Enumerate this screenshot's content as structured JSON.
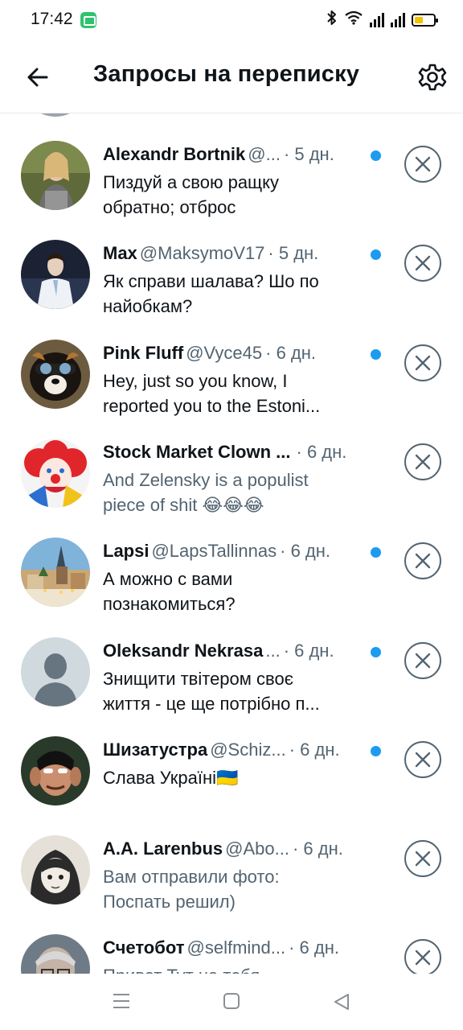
{
  "status_bar": {
    "time": "17:42",
    "icons": [
      "message-app-icon",
      "bluetooth-icon",
      "wifi-icon",
      "signal-icon",
      "signal-r-icon",
      "battery-icon"
    ],
    "battery_color": "#f2c200"
  },
  "header": {
    "title": "Запросы на переписку",
    "back_icon": "arrow-left-icon",
    "settings_icon": "gear-icon"
  },
  "colors": {
    "primary_text": "#0f1419",
    "secondary_text": "#536471",
    "unread_dot": "#1d9bf0",
    "divider": "#e7e9ea"
  },
  "requests": [
    {
      "name": "Alexandr Bortnik",
      "handle": "@...",
      "time": "· 5 дн.",
      "unread": true,
      "muted": false,
      "lines": [
        "Пиздуй а свою ращку",
        "обратно; отброс"
      ]
    },
    {
      "name": "Max",
      "handle": "@MaksymoV17",
      "time": "· 5 дн.",
      "unread": true,
      "muted": false,
      "lines": [
        "Як справи шалава? Шо по",
        "найобкам?"
      ]
    },
    {
      "name": "Pink Fluff",
      "handle": "@Vyce45",
      "time": "· 6 дн.",
      "unread": true,
      "muted": false,
      "lines": [
        "Hey, just so you know, I",
        "reported you to the Estoni..."
      ]
    },
    {
      "name": "Stock Market Clown ...",
      "handle": "",
      "time": "· 6 дн.",
      "unread": false,
      "muted": true,
      "lines": [
        "And Zelensky is a populist",
        "piece of shit 😂😂😂"
      ]
    },
    {
      "name": "Lapsi",
      "handle": "@LapsTallinnas",
      "time": "· 6 дн.",
      "unread": true,
      "muted": false,
      "lines": [
        "А можно с вами",
        "познакомиться?"
      ]
    },
    {
      "name": "Oleksandr Nekrasa",
      "handle": "...",
      "time": "· 6 дн.",
      "unread": true,
      "muted": false,
      "lines": [
        "Знищити твітером своє",
        "життя - це ще потрібно п..."
      ]
    },
    {
      "name": "Шизатустра",
      "handle": "@Schiz...",
      "time": "· 6 дн.",
      "unread": true,
      "muted": false,
      "lines": [
        "Слава Україні🇺🇦"
      ]
    },
    {
      "name": "A.A. Larenbus",
      "handle": "@Abo...",
      "time": "· 6 дн.",
      "unread": false,
      "muted": true,
      "lines": [
        "Вам отправили фото:",
        "Поспать решил)"
      ]
    },
    {
      "name": "Счетобот",
      "handle": "@selfmind...",
      "time": "· 6 дн.",
      "unread": false,
      "muted": true,
      "lines": [
        "Привет Тут на тебя"
      ]
    }
  ],
  "nav_bar": {
    "icons": [
      "menu-icon",
      "home-square-icon",
      "back-triangle-icon"
    ]
  }
}
